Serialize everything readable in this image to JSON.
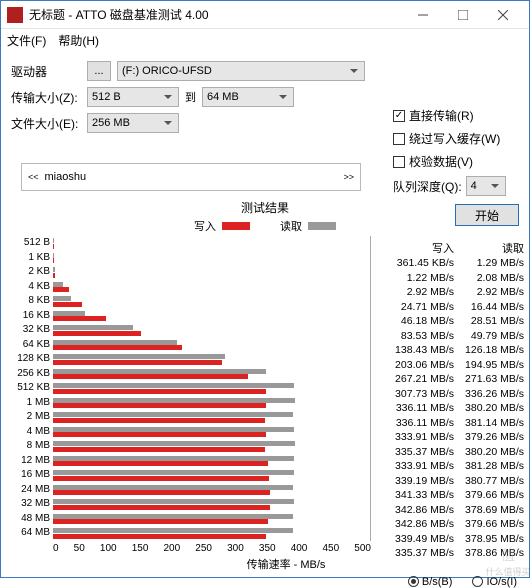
{
  "window": {
    "title": "无标题 - ATTO 磁盘基准测试 4.00"
  },
  "menu": {
    "file": "文件(F)",
    "help": "帮助(H)"
  },
  "controls": {
    "drive_label": "驱动器",
    "browse_btn": "...",
    "drive_value": "(F:) ORICO-UFSD",
    "xfer_label": "传输大小(Z):",
    "xfer_from": "512 B",
    "to_label": "到",
    "xfer_to": "64 MB",
    "filesize_label": "文件大小(E):",
    "filesize_value": "256 MB"
  },
  "options": {
    "direct": {
      "label": "直接传输(R)",
      "checked": true
    },
    "bypass": {
      "label": "绕过写入缓存(W)",
      "checked": false
    },
    "verify": {
      "label": "校验数据(V)",
      "checked": false
    },
    "depth_label": "队列深度(Q):",
    "depth_value": "4",
    "start": "开始"
  },
  "desc": {
    "text": "miaoshu"
  },
  "chart_title": "测试结果",
  "legend": {
    "write": "写入",
    "read": "读取"
  },
  "axis": {
    "xlabel": "传输速率 - MB/s"
  },
  "xticks": [
    "0",
    "50",
    "100",
    "150",
    "200",
    "250",
    "300",
    "350",
    "400",
    "450",
    "500"
  ],
  "chart_data": {
    "type": "bar",
    "xlabel": "传输速率 - MB/s",
    "ylabel": "",
    "xlim": [
      0,
      500
    ],
    "categories": [
      "512 B",
      "1 KB",
      "2 KB",
      "4 KB",
      "8 KB",
      "16 KB",
      "32 KB",
      "64 KB",
      "128 KB",
      "256 KB",
      "512 KB",
      "1 MB",
      "2 MB",
      "4 MB",
      "8 MB",
      "12 MB",
      "16 MB",
      "24 MB",
      "32 MB",
      "48 MB",
      "64 MB"
    ],
    "series": [
      {
        "name": "写入",
        "unit": "MB/s",
        "raw": [
          "361.45 KB/s",
          "1.22 MB/s",
          "2.92 MB/s",
          "24.71 MB/s",
          "46.18 MB/s",
          "83.53 MB/s",
          "138.43 MB/s",
          "203.06 MB/s",
          "267.21 MB/s",
          "307.73 MB/s",
          "336.11 MB/s",
          "336.11 MB/s",
          "333.91 MB/s",
          "335.37 MB/s",
          "333.91 MB/s",
          "339.19 MB/s",
          "341.33 MB/s",
          "342.86 MB/s",
          "342.86 MB/s",
          "339.49 MB/s",
          "335.37 MB/s"
        ],
        "values": [
          0.36,
          1.22,
          2.92,
          24.71,
          46.18,
          83.53,
          138.43,
          203.06,
          267.21,
          307.73,
          336.11,
          336.11,
          333.91,
          335.37,
          333.91,
          339.19,
          341.33,
          342.86,
          342.86,
          339.49,
          335.37
        ]
      },
      {
        "name": "读取",
        "unit": "MB/s",
        "raw": [
          "1.29 MB/s",
          "2.08 MB/s",
          "2.92 MB/s",
          "16.44 MB/s",
          "28.51 MB/s",
          "49.79 MB/s",
          "126.18 MB/s",
          "194.95 MB/s",
          "271.63 MB/s",
          "336.26 MB/s",
          "380.20 MB/s",
          "381.14 MB/s",
          "379.26 MB/s",
          "380.20 MB/s",
          "381.28 MB/s",
          "380.77 MB/s",
          "379.66 MB/s",
          "378.69 MB/s",
          "379.66 MB/s",
          "378.95 MB/s",
          "378.86 MB/s"
        ],
        "values": [
          1.29,
          2.08,
          2.92,
          16.44,
          28.51,
          49.79,
          126.18,
          194.95,
          271.63,
          336.26,
          380.2,
          381.14,
          379.26,
          380.2,
          381.28,
          380.77,
          379.66,
          378.69,
          379.66,
          378.95,
          378.86
        ]
      }
    ]
  },
  "units_toggle": {
    "bps": "B/s(B)",
    "iops": "IO/s(I)",
    "selected": "bps"
  },
  "table_hdr": {
    "write": "写入",
    "read": "读取"
  },
  "watermark": "值(得)买\n什么值得买"
}
